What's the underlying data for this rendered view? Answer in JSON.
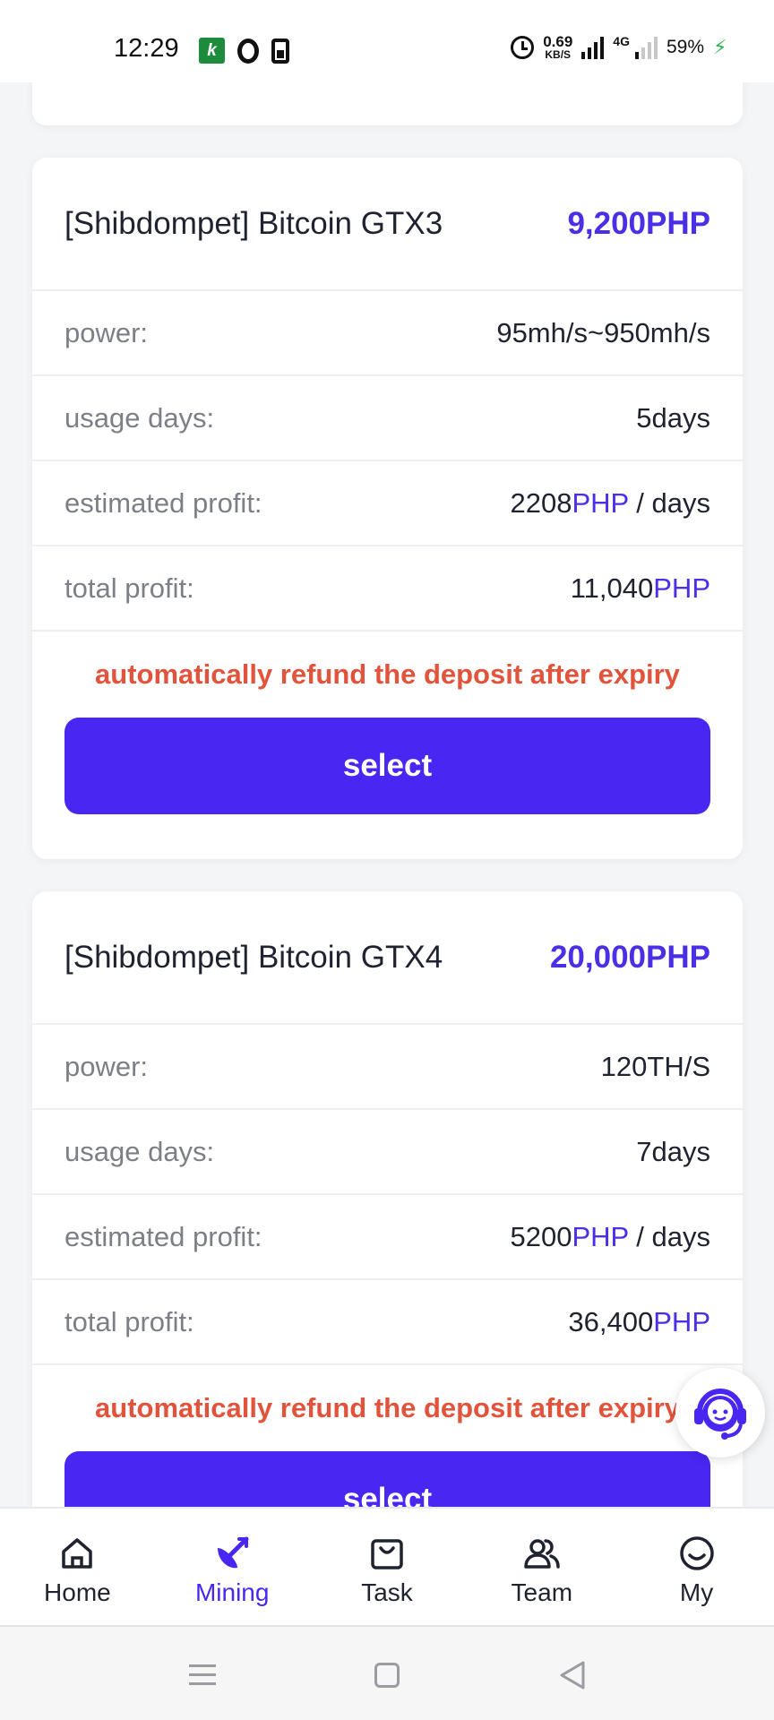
{
  "status_bar": {
    "time": "12:29",
    "app_k": "k",
    "net_speed_value": "0.69",
    "net_speed_unit": "KB/S",
    "network_type": "4G",
    "battery": "59%"
  },
  "plans": [
    {
      "title": "[Shibdompet] Bitcoin GTX3",
      "price": "9,200PHP",
      "power_label": "power:",
      "power_value": "95mh/s~950mh/s",
      "days_label": "usage days:",
      "days_value": "5days",
      "est_label": "estimated profit:",
      "est_amount": "2208",
      "est_currency": "PHP",
      "est_suffix": " / days",
      "total_label": "total profit:",
      "total_amount": "11,040",
      "total_currency": "PHP",
      "note": "automatically refund the deposit after expiry",
      "button": "select"
    },
    {
      "title": "[Shibdompet] Bitcoin GTX4",
      "price": "20,000PHP",
      "power_label": "power:",
      "power_value": "120TH/S",
      "days_label": "usage days:",
      "days_value": "7days",
      "est_label": "estimated profit:",
      "est_amount": "5200",
      "est_currency": "PHP",
      "est_suffix": " / days",
      "total_label": "total profit:",
      "total_amount": "36,400",
      "total_currency": "PHP",
      "note": "automatically refund the deposit after expiry",
      "button": "select"
    }
  ],
  "bottom_nav": {
    "items": [
      {
        "label": "Home",
        "icon": "home-icon"
      },
      {
        "label": "Mining",
        "icon": "mining-icon",
        "active": true
      },
      {
        "label": "Task",
        "icon": "task-bag-icon"
      },
      {
        "label": "Team",
        "icon": "team-icon"
      },
      {
        "label": "My",
        "icon": "smile-icon"
      }
    ]
  },
  "colors": {
    "accent": "#4a26f2",
    "price": "#4a2fe6",
    "warning": "#e2533c"
  }
}
